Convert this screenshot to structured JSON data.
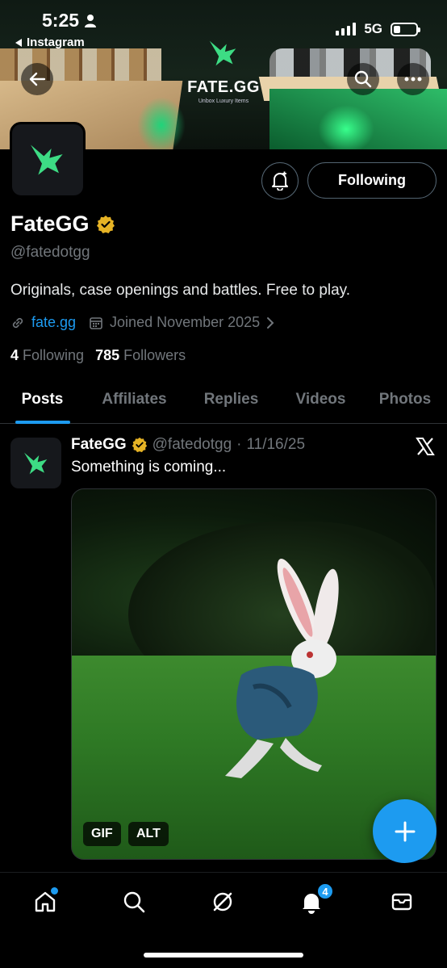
{
  "status_bar": {
    "time": "5:25",
    "back_app": "Instagram",
    "network": "5G",
    "battery_level": 0.3
  },
  "banner": {
    "brand_name": "FATE.GG",
    "tagline": "Unbox Luxury Items"
  },
  "profile": {
    "name": "FateGG",
    "handle": "@fatedotgg",
    "bio": "Originals, case openings and battles. Free to play.",
    "website": "fate.gg",
    "joined": "Joined November 2025",
    "following_count": "4",
    "following_label": "Following",
    "followers_count": "785",
    "followers_label": "Followers",
    "follow_button_label": "Following"
  },
  "tabs": [
    {
      "label": "Posts",
      "active": true
    },
    {
      "label": "Affiliates",
      "active": false
    },
    {
      "label": "Replies",
      "active": false
    },
    {
      "label": "Videos",
      "active": false
    },
    {
      "label": "Photos",
      "active": false
    }
  ],
  "post": {
    "author": "FateGG",
    "handle": "@fatedotgg",
    "date": "11/16/25",
    "text": "Something is coming...",
    "media_tags": [
      "GIF",
      "ALT"
    ]
  },
  "bottom_nav": {
    "items": [
      "home-icon",
      "search-icon",
      "grok-icon",
      "notifications-icon",
      "messages-icon"
    ],
    "notification_badge": "4"
  },
  "colors": {
    "accent": "#1d9bf0",
    "verified": "#e6b325",
    "brand_green": "#3ddc84"
  }
}
